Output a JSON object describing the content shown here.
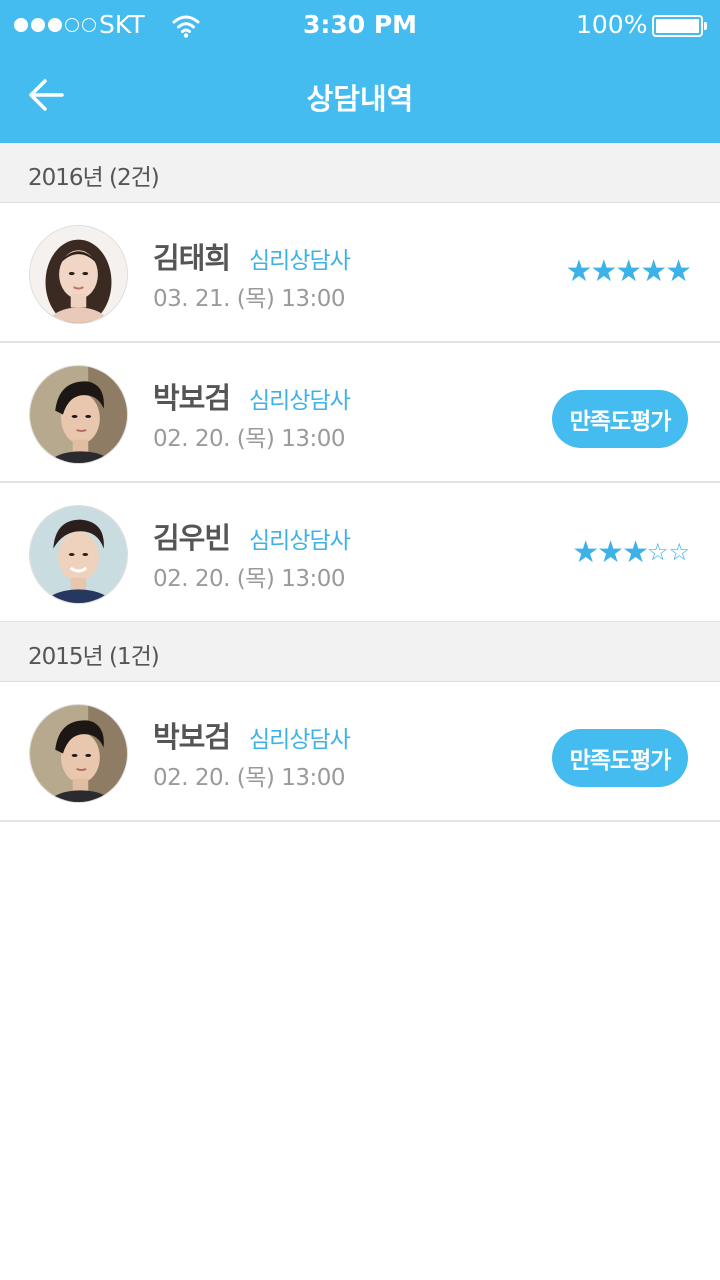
{
  "status_bar": {
    "carrier": "SKT",
    "time": "3:30 PM",
    "battery": "100%",
    "signal_bars": 3,
    "signal_max": 5
  },
  "header": {
    "title": "상담내역"
  },
  "colors": {
    "accent": "#45bcf0",
    "text_accent": "#3cb2e8"
  },
  "sections": [
    {
      "label": "2016년 (2건)"
    },
    {
      "label": "2015년 (1건)"
    }
  ],
  "items": [
    {
      "name": "김태희",
      "role": "심리상담사",
      "datetime": "03. 21. (목) 13:00",
      "rating": 5,
      "rating_max": 5
    },
    {
      "name": "박보검",
      "role": "심리상담사",
      "datetime": "02. 20. (목) 13:00",
      "button": "만족도평가"
    },
    {
      "name": "김우빈",
      "role": "심리상담사",
      "datetime": "02. 20. (목) 13:00",
      "rating": 3,
      "rating_max": 5
    },
    {
      "name": "박보검",
      "role": "심리상담사",
      "datetime": "02. 20. (목) 13:00",
      "button": "만족도평가"
    }
  ]
}
